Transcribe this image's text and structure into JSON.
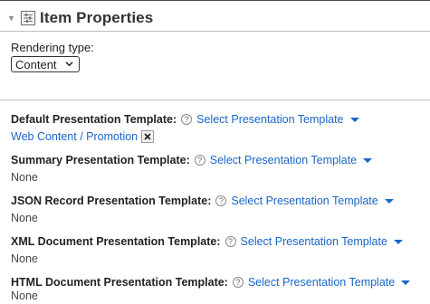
{
  "panel": {
    "title": "Item Properties",
    "rendering_label": "Rendering type:",
    "rendering_value": "Content"
  },
  "help_glyph": "?",
  "templates": [
    {
      "label": "Default Presentation Template:",
      "action": "Select Presentation Template",
      "value": "Web Content / Promotion",
      "removable": true
    },
    {
      "label": "Summary Presentation Template:",
      "action": "Select Presentation Template",
      "value": "None"
    },
    {
      "label": "JSON Record Presentation Template:",
      "action": "Select Presentation Template",
      "value": "None"
    },
    {
      "label": "XML Document Presentation Template:",
      "action": "Select Presentation Template",
      "value": "None"
    },
    {
      "label": "HTML Document Presentation Template:",
      "action": "Select Presentation Template",
      "value": "None"
    }
  ],
  "colors": {
    "link": "#1a66c9",
    "text": "#222222",
    "divider": "#bdbdbd"
  },
  "icons": [
    "collapse-arrow-icon",
    "properties-icon",
    "chevron-down-icon",
    "help-icon",
    "dropdown-caret-icon",
    "remove-icon"
  ]
}
